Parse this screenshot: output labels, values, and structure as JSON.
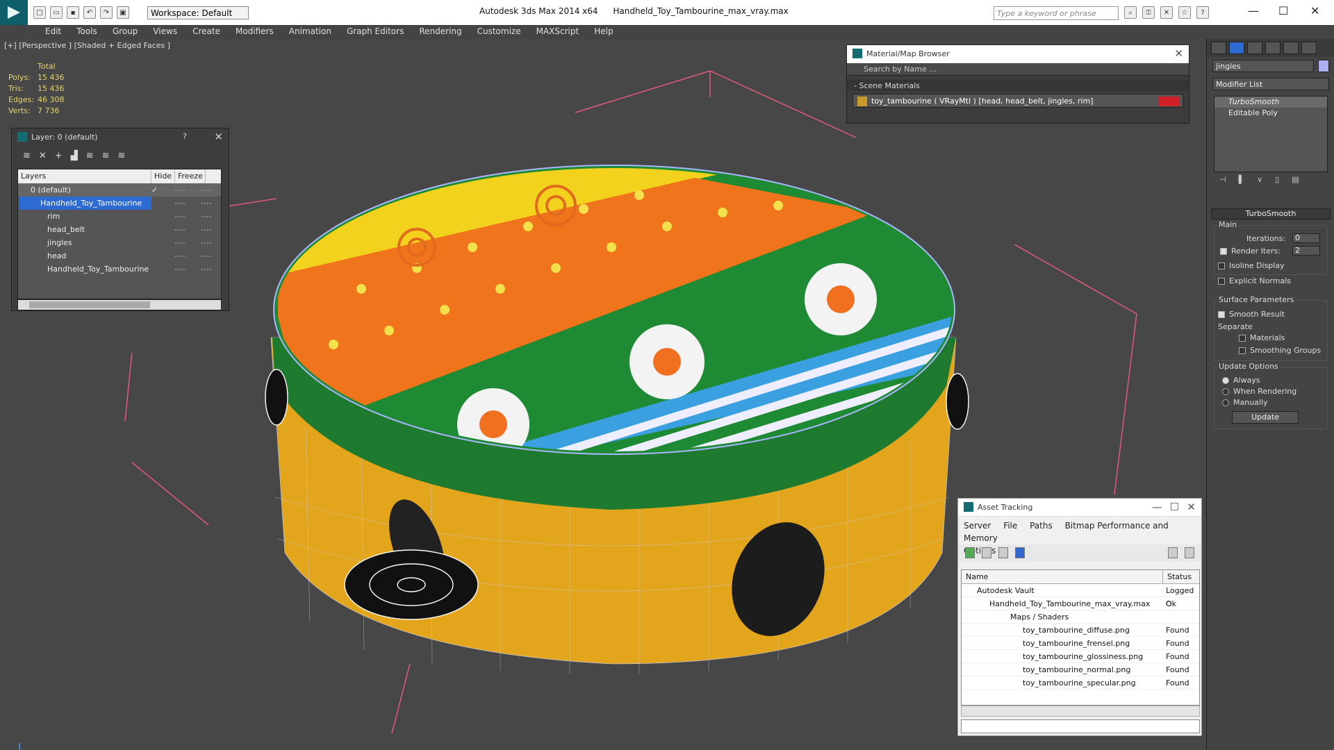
{
  "app": {
    "title": "Autodesk 3ds Max  2014 x64",
    "file": "Handheld_Toy_Tambourine_max_vray.max",
    "workspace": "Workspace: Default",
    "search_placeholder": "Type a keyword or phrase"
  },
  "menu": [
    "Edit",
    "Tools",
    "Group",
    "Views",
    "Create",
    "Modifiers",
    "Animation",
    "Graph Editors",
    "Rendering",
    "Customize",
    "MAXScript",
    "Help"
  ],
  "viewport": {
    "label": "[+] [Perspective ] [Shaded + Edged Faces ]",
    "stats_header": "Total",
    "stats": [
      {
        "k": "Polys:",
        "v": "15 436"
      },
      {
        "k": "Tris:",
        "v": "15 436"
      },
      {
        "k": "Edges:",
        "v": "46 308"
      },
      {
        "k": "Verts:",
        "v": "7 736"
      }
    ]
  },
  "layer_panel": {
    "title": "Layer: 0 (default)",
    "help": "?",
    "col_layers": "Layers",
    "col_hide": "Hide",
    "col_freeze": "Freeze",
    "rows": [
      "0 (default)",
      "Handheld_Toy_Tambourine",
      "rim",
      "head_belt",
      "jingles",
      "head",
      "Handheld_Toy_Tambourine"
    ]
  },
  "material_browser": {
    "title": "Material/Map Browser",
    "search": "Search by Name ...",
    "section": "- Scene Materials",
    "item": "toy_tambourine  ( VRayMtl )  [head, head_belt, jingles, rim]"
  },
  "asset_tracking": {
    "title": "Asset Tracking",
    "menu": [
      "Server",
      "File",
      "Paths",
      "Bitmap Performance and Memory",
      "Options"
    ],
    "col_name": "Name",
    "col_status": "Status",
    "rows": [
      {
        "name": "Autodesk Vault",
        "status": "Logged O"
      },
      {
        "name": "Handheld_Toy_Tambourine_max_vray.max",
        "status": "Ok"
      },
      {
        "name": "Maps / Shaders",
        "status": ""
      },
      {
        "name": "toy_tambourine_diffuse.png",
        "status": "Found"
      },
      {
        "name": "toy_tambourine_frensel.png",
        "status": "Found"
      },
      {
        "name": "toy_tambourine_glossiness.png",
        "status": "Found"
      },
      {
        "name": "toy_tambourine_normal.png",
        "status": "Found"
      },
      {
        "name": "toy_tambourine_specular.png",
        "status": "Found"
      }
    ]
  },
  "command_panel": {
    "object_name": "jingles",
    "object_color": "#aab0ee",
    "modifier_list": "Modifier List",
    "stack": [
      "TurboSmooth",
      "Editable Poly"
    ],
    "rollout": "TurboSmooth",
    "main_group": "Main",
    "iterations_label": "Iterations:",
    "iterations": "0",
    "render_iters_label": "Render Iters:",
    "render_iters": "2",
    "isoline": "Isoline Display",
    "explicit_normals": "Explicit Normals",
    "surface_group": "Surface Parameters",
    "smooth_result": "Smooth Result",
    "separate": "Separate",
    "materials": "Materials",
    "smoothing_groups": "Smoothing Groups",
    "update_group": "Update Options",
    "always": "Always",
    "when_rendering": "When Rendering",
    "manually": "Manually",
    "update_button": "Update"
  },
  "colors": {
    "accent": "#146c73",
    "viewport_bg": "#474747",
    "selection": "#2d6bd2"
  }
}
